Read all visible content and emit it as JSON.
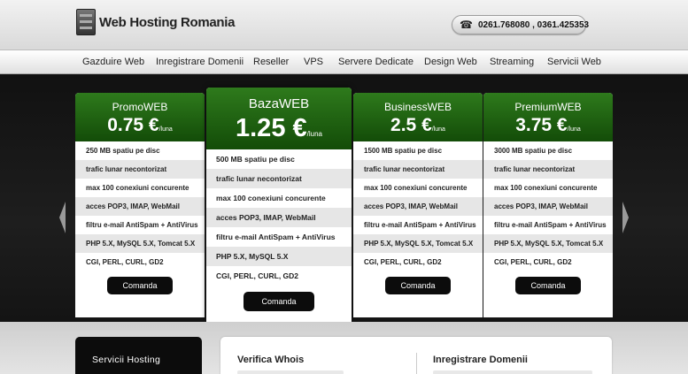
{
  "header": {
    "logo_text": "Web Hosting Romania",
    "phone": "0261.768080 , 0361.425353"
  },
  "nav": {
    "items": [
      {
        "label": "Gazduire Web"
      },
      {
        "label": "Inregistrare Domenii"
      },
      {
        "label": "Reseller"
      },
      {
        "label": "VPS"
      },
      {
        "label": "Servere Dedicate"
      },
      {
        "label": "Design Web"
      },
      {
        "label": "Streaming"
      },
      {
        "label": "Servicii Web"
      }
    ]
  },
  "plans": [
    {
      "name": "PromoWEB",
      "price": "0.75 €",
      "per": "/luna",
      "features": [
        "250 MB spatiu pe disc",
        "trafic lunar necontorizat",
        "max 100 conexiuni concurente",
        "acces POP3, IMAP, WebMail",
        "filtru e-mail AntiSpam + AntiVirus",
        "PHP 5.X, MySQL 5.X, Tomcat 5.X",
        "CGI, PERL, CURL, GD2"
      ],
      "button": "Comanda"
    },
    {
      "name": "BazaWEB",
      "price": "1.25 €",
      "per": "/luna",
      "features": [
        "500 MB spatiu pe disc",
        "trafic lunar necontorizat",
        "max 100 conexiuni concurente",
        "acces POP3, IMAP, WebMail",
        "filtru e-mail AntiSpam + AntiVirus",
        "PHP 5.X, MySQL 5.X",
        "CGI, PERL, CURL, GD2"
      ],
      "button": "Comanda"
    },
    {
      "name": "BusinessWEB",
      "price": "2.5 €",
      "per": "/luna",
      "features": [
        "1500 MB spatiu pe disc",
        "trafic lunar necontorizat",
        "max 100 conexiuni concurente",
        "acces POP3, IMAP, WebMail",
        "filtru e-mail AntiSpam + AntiVirus",
        "PHP 5.X, MySQL 5.X, Tomcat 5.X",
        "CGI, PERL, CURL, GD2"
      ],
      "button": "Comanda"
    },
    {
      "name": "PremiumWEB",
      "price": "3.75 €",
      "per": "/luna",
      "features": [
        "3000 MB spatiu pe disc",
        "trafic lunar necontorizat",
        "max 100 conexiuni concurente",
        "acces POP3, IMAP, WebMail",
        "filtru e-mail AntiSpam + AntiVirus",
        "PHP 5.X, MySQL 5.X, Tomcat 5.X",
        "CGI, PERL, CURL, GD2"
      ],
      "button": "Comanda"
    }
  ],
  "bottom": {
    "services_title": "Servicii Hosting",
    "whois_title": "Verifica Whois",
    "domains_title": "Inregistrare Domenii"
  },
  "colors": {
    "plan_header": "#1f6411",
    "hero_bg": "#141414",
    "button_bg": "#0c0c0c"
  }
}
